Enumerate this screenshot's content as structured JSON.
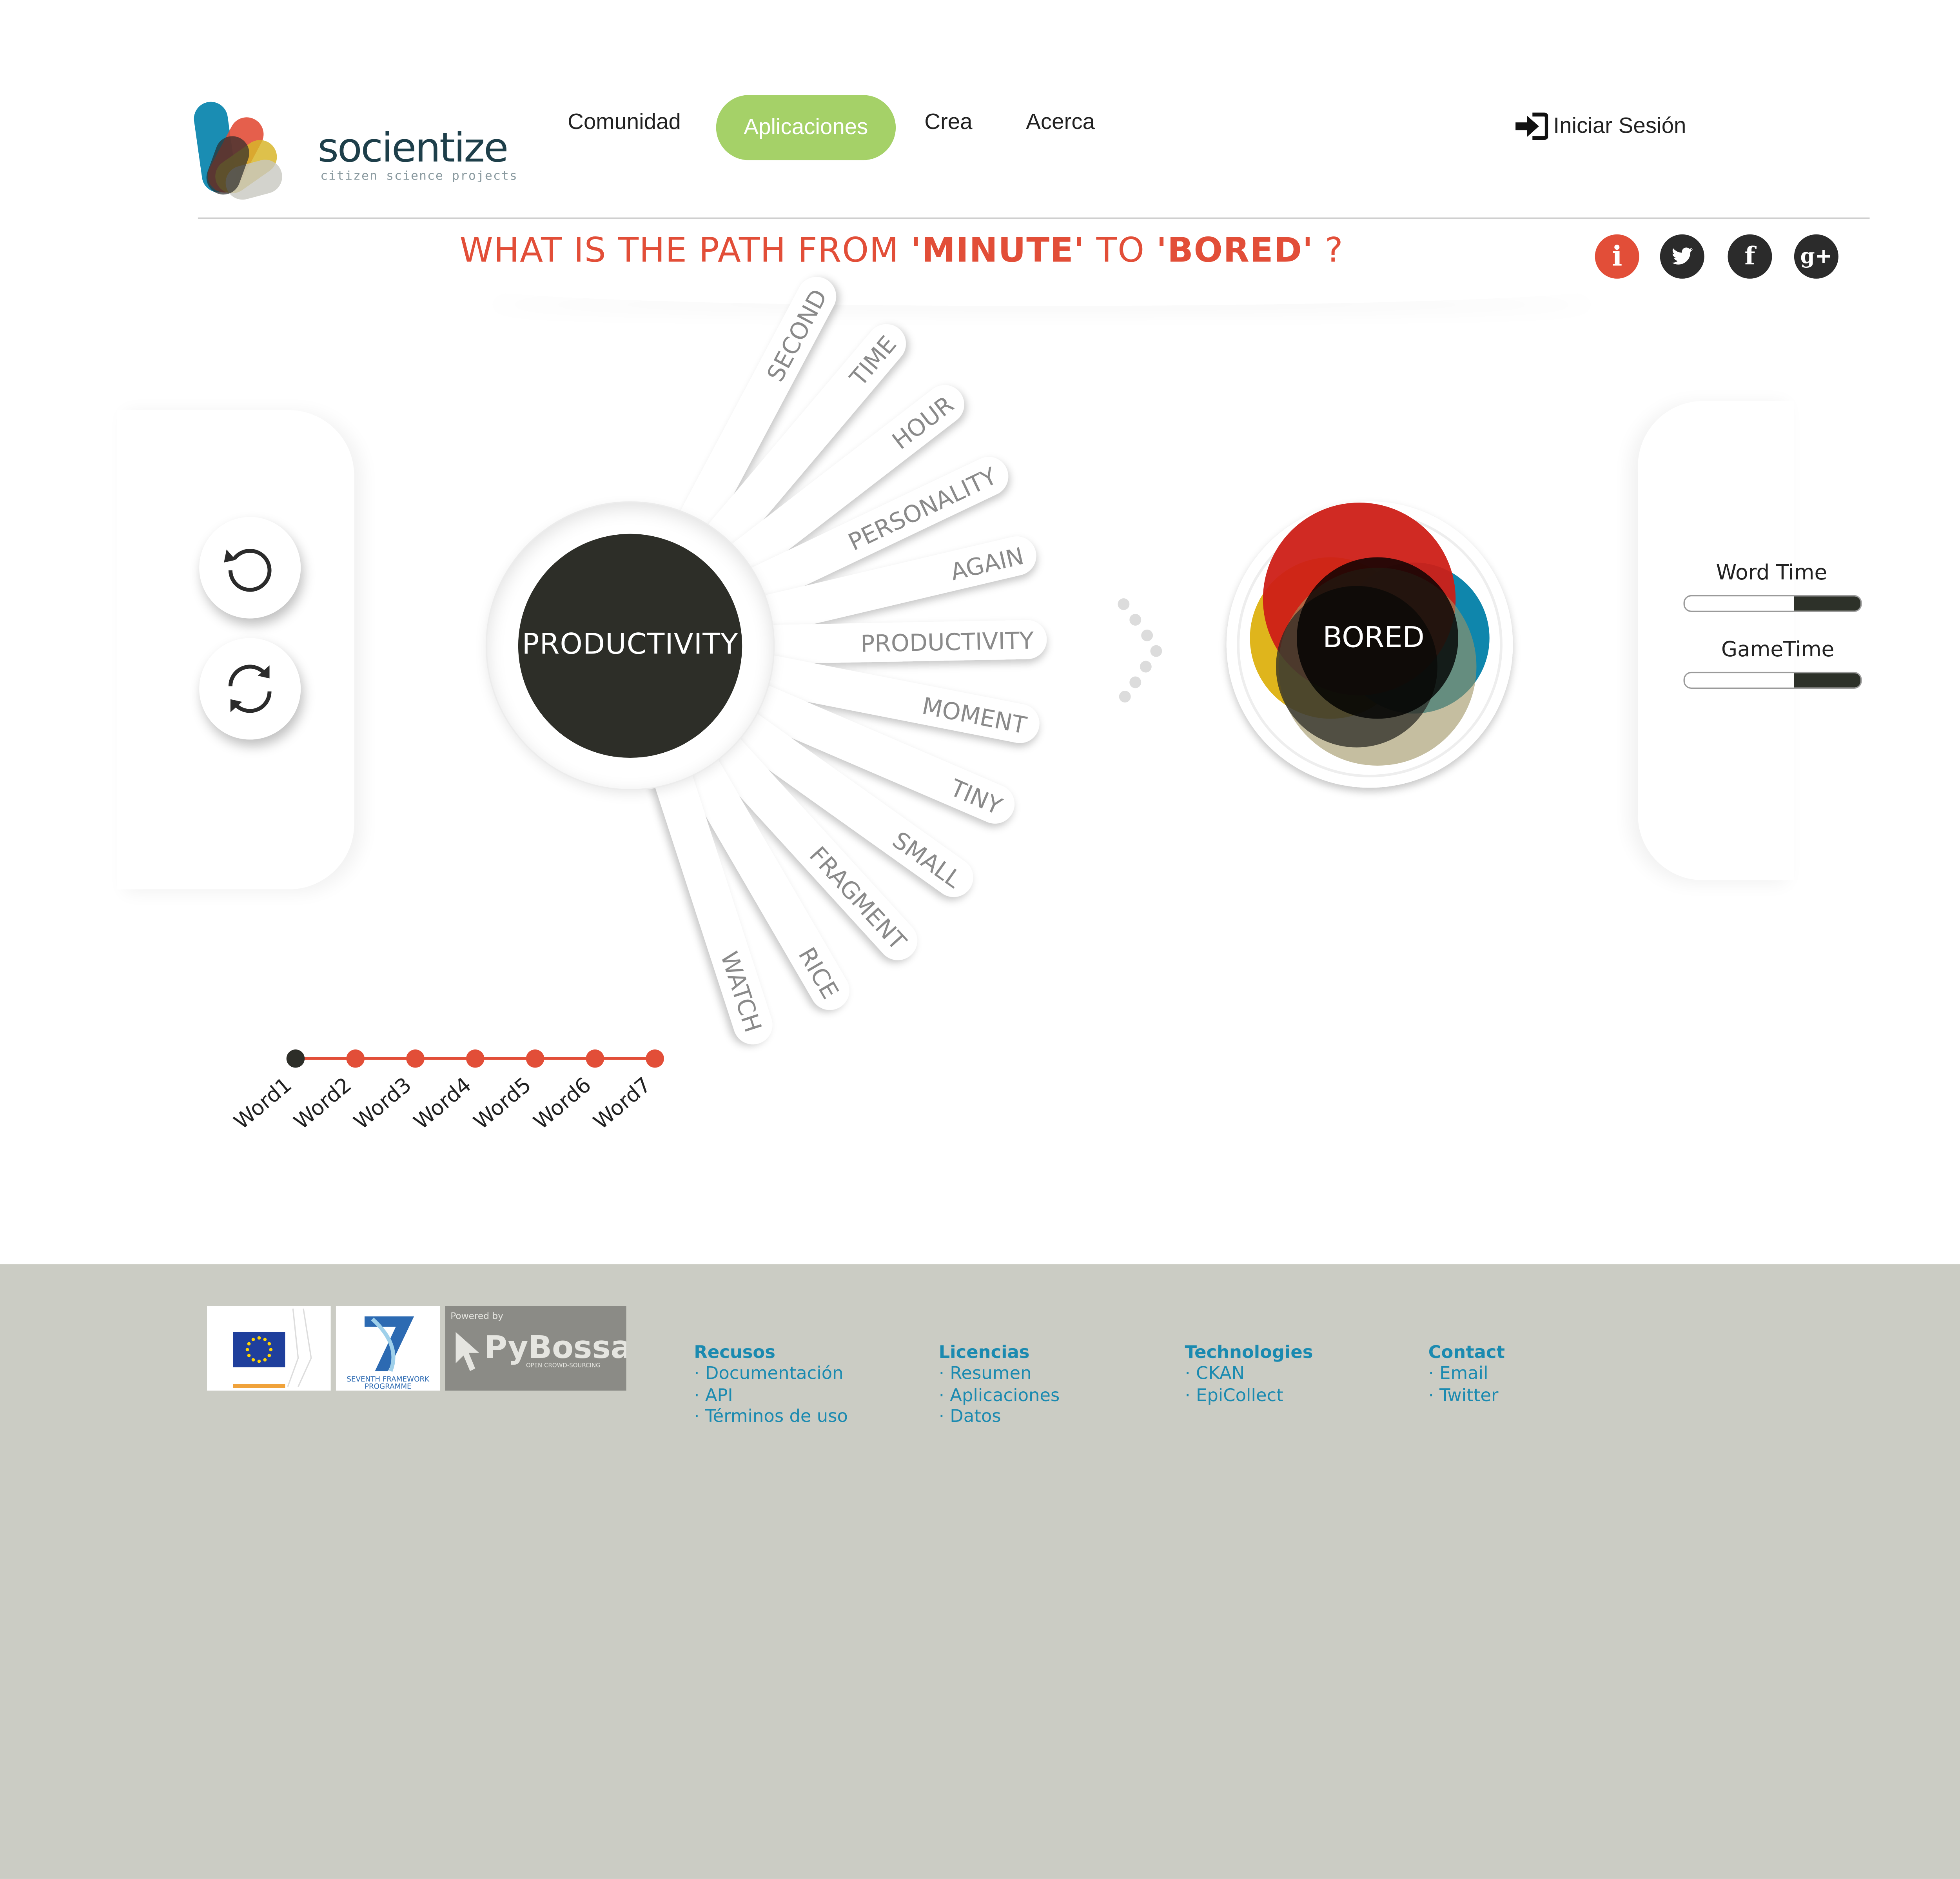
{
  "header": {
    "logo_text": "socientize",
    "logo_subtitle": "citizen science projects",
    "nav": [
      "Comunidad",
      "Aplicaciones",
      "Crea",
      "Acerca"
    ],
    "active_nav": "Aplicaciones",
    "login_label": "Iniciar Sesión"
  },
  "question": {
    "prefix": "WHAT IS THE PATH FROM ",
    "from_word": "'MINUTE'",
    "middle": " TO ",
    "to_word": "'BORED'",
    "suffix": " ?"
  },
  "social": {
    "info_icon": "i",
    "facebook_icon": "f",
    "google_icon": "g+"
  },
  "game": {
    "current_word": "PRODUCTIVITY",
    "target_word": "BORED",
    "options": [
      "SECOND",
      "TIME",
      "HOUR",
      "PERSONALITY",
      "AGAIN",
      "PRODUCTIVITY",
      "MOMENT",
      "TINY",
      "SMALL",
      "FRAGMENT",
      "RICE",
      "WATCH"
    ],
    "controls": [
      "undo-icon",
      "restart-icon"
    ],
    "timers": [
      {
        "label": "Word Time",
        "remaining": 0.38
      },
      {
        "label": "GameTime",
        "remaining": 0.38
      }
    ],
    "path": {
      "steps": [
        "Word1",
        "Word2",
        "Word3",
        "Word4",
        "Word5",
        "Word6",
        "Word7"
      ],
      "current_index": 0,
      "colors": {
        "current": "#2d2e28",
        "pending": "#e24e38"
      }
    }
  },
  "colors": {
    "accent": "#e24e38",
    "nav_active": "#a5d168",
    "dark": "#2d2e28",
    "footer_bg": "#cbccc4",
    "footer_link": "#1b8ab0"
  },
  "footer": {
    "logos": [
      "European Commission",
      "SEVENTH FRAMEWORK PROGRAMME",
      "PyBossa"
    ],
    "columns": [
      {
        "title": "Recusos",
        "items": [
          "Documentación",
          "API",
          "Términos de uso"
        ]
      },
      {
        "title": "Licencias",
        "items": [
          "Resumen",
          "Aplicaciones",
          "Datos"
        ]
      },
      {
        "title": "Technologies",
        "items": [
          "CKAN",
          "EpiCollect"
        ]
      },
      {
        "title": "Contact",
        "items": [
          "Email",
          "Twitter"
        ]
      }
    ],
    "pybossa_caption": "Powered by",
    "pybossa_tagline": "OPEN CROWD-SOURCING",
    "ec_caption": "European Commission"
  }
}
